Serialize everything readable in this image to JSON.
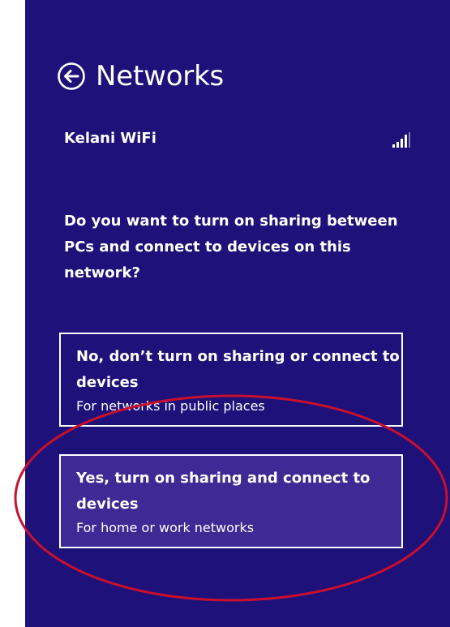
{
  "header": {
    "title": "Networks",
    "back_icon": "back-arrow-circle-icon"
  },
  "network": {
    "name": "Kelani WiFi",
    "status": "",
    "signal_icon": "wifi-signal-icon"
  },
  "prompt": {
    "question": "Do you want to turn on sharing between PCs and connect to devices on this network?"
  },
  "options": {
    "no": {
      "title": "No, don’t turn on sharing or connect to devices",
      "description": "For networks in public places"
    },
    "yes": {
      "title": "Yes, turn on sharing and connect to devices",
      "description": "For home or work networks"
    }
  },
  "colors": {
    "panel_background": "#1e117a",
    "selected_option_background": "#3d2a94",
    "text": "#ffffff",
    "annotation_ellipse": "#c8102e"
  }
}
